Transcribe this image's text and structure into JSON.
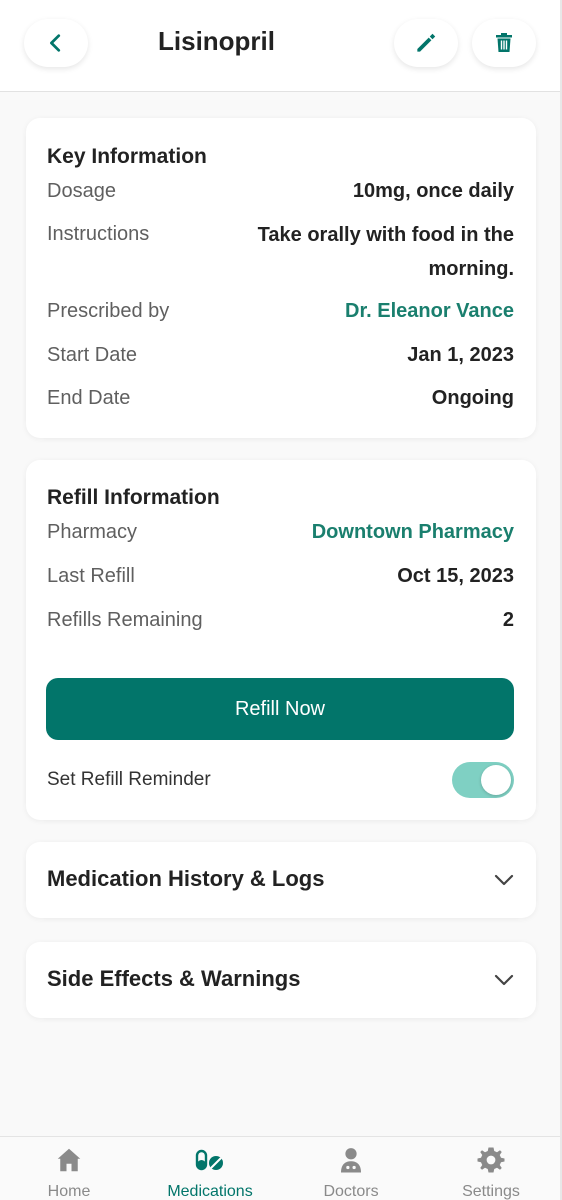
{
  "header": {
    "title": "Lisinopril",
    "back_icon": "chevron-left-icon",
    "edit_icon": "pencil-icon",
    "delete_icon": "trash-icon"
  },
  "key_info": {
    "title": "Key Information",
    "rows": [
      {
        "label": "Dosage",
        "value": "10mg, once daily"
      },
      {
        "label": "Instructions",
        "value": "Take orally with food in the morning."
      },
      {
        "label": "Prescribed by",
        "value": "Dr. Eleanor Vance"
      },
      {
        "label": "Start Date",
        "value": "Jan 1, 2023"
      },
      {
        "label": "End Date",
        "value": "Ongoing"
      }
    ]
  },
  "refill_info": {
    "title": "Refill Information",
    "rows": [
      {
        "label": "Pharmacy",
        "value": "Downtown Pharmacy"
      },
      {
        "label": "Last Refill",
        "value": "Oct 15, 2023"
      },
      {
        "label": "Refills Remaining",
        "value": "2"
      }
    ],
    "refill_button": "Refill Now",
    "reminder_label": "Set Refill Reminder",
    "reminder_on": true
  },
  "accordions": [
    {
      "title": "Medication History & Logs",
      "icon": "chevron-down-icon"
    },
    {
      "title": "Side Effects & Warnings",
      "icon": "chevron-down-icon"
    }
  ],
  "bottom_nav": {
    "items": [
      {
        "label": "Home",
        "icon": "home-icon"
      },
      {
        "label": "Medications",
        "icon": "pills-icon",
        "active": true
      },
      {
        "label": "Doctors",
        "icon": "doctor-icon"
      },
      {
        "label": "Settings",
        "icon": "gear-icon"
      }
    ]
  },
  "colors": {
    "accent": "#02756a",
    "link": "#1a7f6e",
    "toggle_on": "#7fd0c3"
  }
}
